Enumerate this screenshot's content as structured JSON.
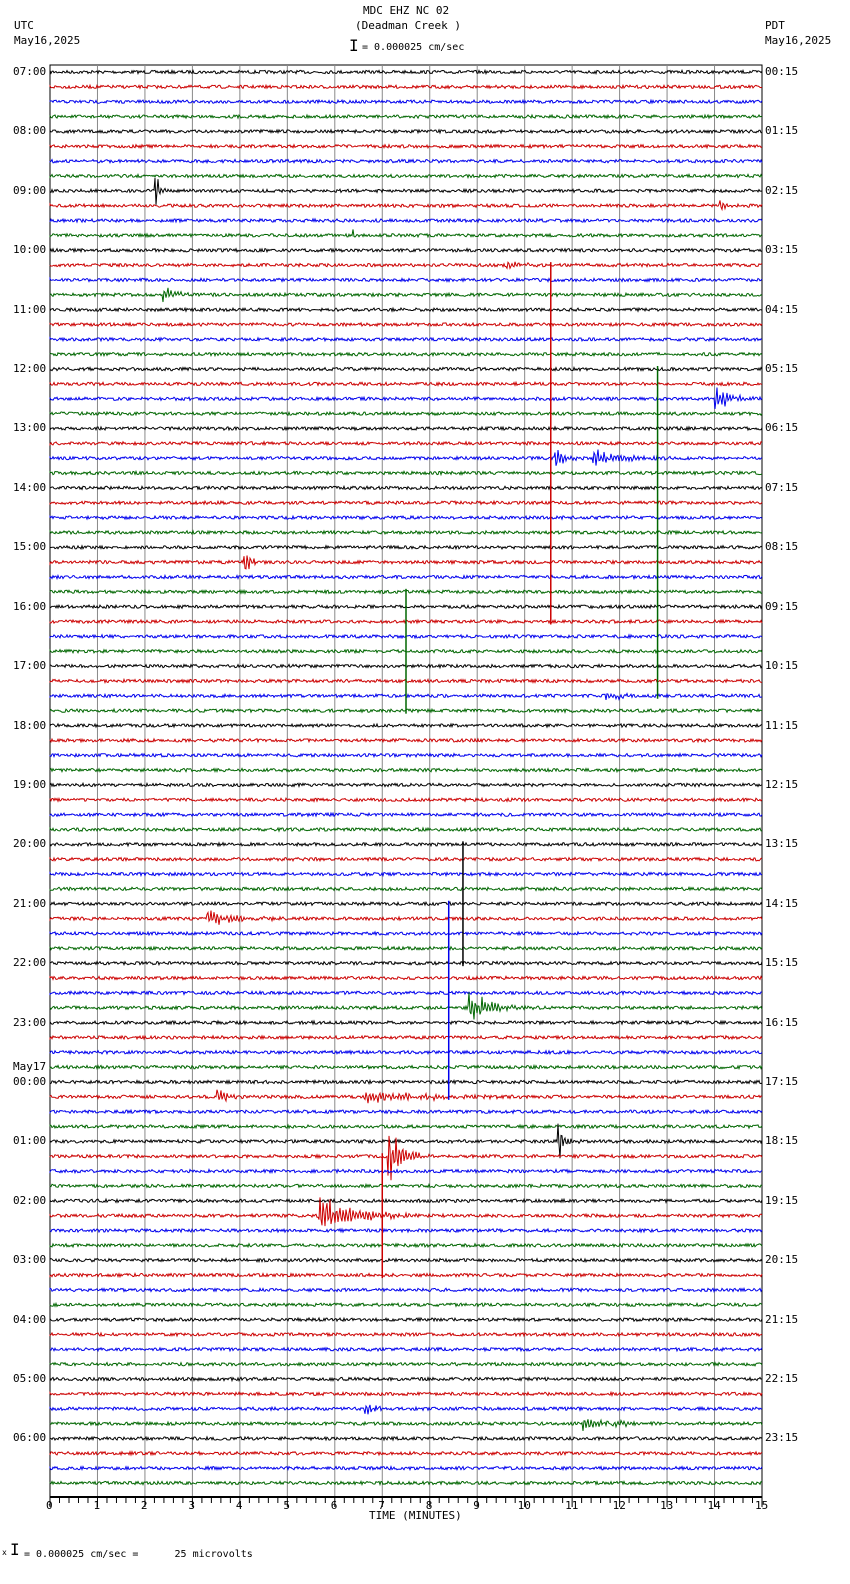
{
  "header": {
    "title": "MDC EHZ NC 02",
    "subtitle": "(Deadman Creek )",
    "left_tz": "UTC",
    "left_date": "May16,2025",
    "right_tz": "PDT",
    "right_date": "May16,2025",
    "scale": "= 0.000025 cm/sec"
  },
  "footer": {
    "scale": "= 0.000025 cm/sec =      25 microvolts",
    "prefix": "x"
  },
  "chart_data": {
    "type": "line",
    "title": "MDC EHZ NC 02 (Deadman Creek )",
    "xlabel": "TIME (MINUTES)",
    "xlim": [
      0,
      15
    ],
    "x_ticks": [
      "0",
      "1",
      "2",
      "3",
      "4",
      "5",
      "6",
      "7",
      "8",
      "9",
      "10",
      "11",
      "12",
      "13",
      "14",
      "15"
    ],
    "trace_colors": [
      "#000000",
      "#cc0000",
      "#0000ee",
      "#006600"
    ],
    "traces_per_hour": 4,
    "left_labels": [
      "07:00",
      "08:00",
      "09:00",
      "10:00",
      "11:00",
      "12:00",
      "13:00",
      "14:00",
      "15:00",
      "16:00",
      "17:00",
      "18:00",
      "19:00",
      "20:00",
      "21:00",
      "22:00",
      "23:00",
      "00:00",
      "01:00",
      "02:00",
      "03:00",
      "04:00",
      "05:00",
      "06:00"
    ],
    "date_change_label": "May17",
    "right_labels": [
      "00:15",
      "01:15",
      "02:15",
      "03:15",
      "04:15",
      "05:15",
      "06:15",
      "07:15",
      "08:15",
      "09:15",
      "10:15",
      "11:15",
      "12:15",
      "13:15",
      "14:15",
      "15:15",
      "16:15",
      "17:15",
      "18:15",
      "19:15",
      "20:15",
      "21:15",
      "22:15",
      "23:15"
    ],
    "events": [
      {
        "trace": 8,
        "minute": 2.2,
        "amp": 1.4,
        "dur": 0.15
      },
      {
        "trace": 9,
        "minute": 14.1,
        "amp": 0.6,
        "dur": 0.1
      },
      {
        "trace": 11,
        "minute": 6.35,
        "amp": 0.6,
        "dur": 0.1
      },
      {
        "trace": 13,
        "minute": 9.6,
        "amp": 0.3,
        "dur": 0.4
      },
      {
        "trace": 15,
        "minute": 2.35,
        "amp": 0.6,
        "dur": 0.4
      },
      {
        "trace": 13,
        "minute": 10.55,
        "span": 24
      },
      {
        "trace": 20,
        "minute": 12.8,
        "span": 22
      },
      {
        "trace": 22,
        "minute": 14.0,
        "amp": 0.7,
        "dur": 0.5
      },
      {
        "trace": 26,
        "minute": 10.6,
        "amp": 0.8,
        "dur": 0.3
      },
      {
        "trace": 26,
        "minute": 11.4,
        "amp": 0.6,
        "dur": 0.8
      },
      {
        "trace": 33,
        "minute": 4.05,
        "amp": 1.2,
        "dur": 0.2
      },
      {
        "trace": 35,
        "minute": 7.5,
        "span": 8
      },
      {
        "trace": 42,
        "minute": 11.7,
        "amp": 0.5,
        "dur": 0.4
      },
      {
        "trace": 56,
        "minute": 8.4,
        "span": 13
      },
      {
        "trace": 52,
        "minute": 8.7,
        "span": 8
      },
      {
        "trace": 63,
        "minute": 8.8,
        "amp": 1.3,
        "dur": 0.6
      },
      {
        "trace": 57,
        "minute": 3.3,
        "amp": 0.6,
        "dur": 0.8
      },
      {
        "trace": 69,
        "minute": 3.5,
        "amp": 0.6,
        "dur": 0.3
      },
      {
        "trace": 69,
        "minute": 6.6,
        "amp": 0.4,
        "dur": 1.8
      },
      {
        "trace": 72,
        "minute": 10.7,
        "amp": 1.4,
        "dur": 0.2
      },
      {
        "trace": 73,
        "minute": 7.0,
        "span": 8
      },
      {
        "trace": 73,
        "minute": 7.1,
        "amp": 2.0,
        "dur": 0.4
      },
      {
        "trace": 77,
        "minute": 5.65,
        "amp": 1.4,
        "dur": 0.9
      },
      {
        "trace": 90,
        "minute": 6.6,
        "amp": 0.6,
        "dur": 0.3
      },
      {
        "trace": 91,
        "minute": 11.2,
        "amp": 0.4,
        "dur": 1.0
      }
    ]
  }
}
